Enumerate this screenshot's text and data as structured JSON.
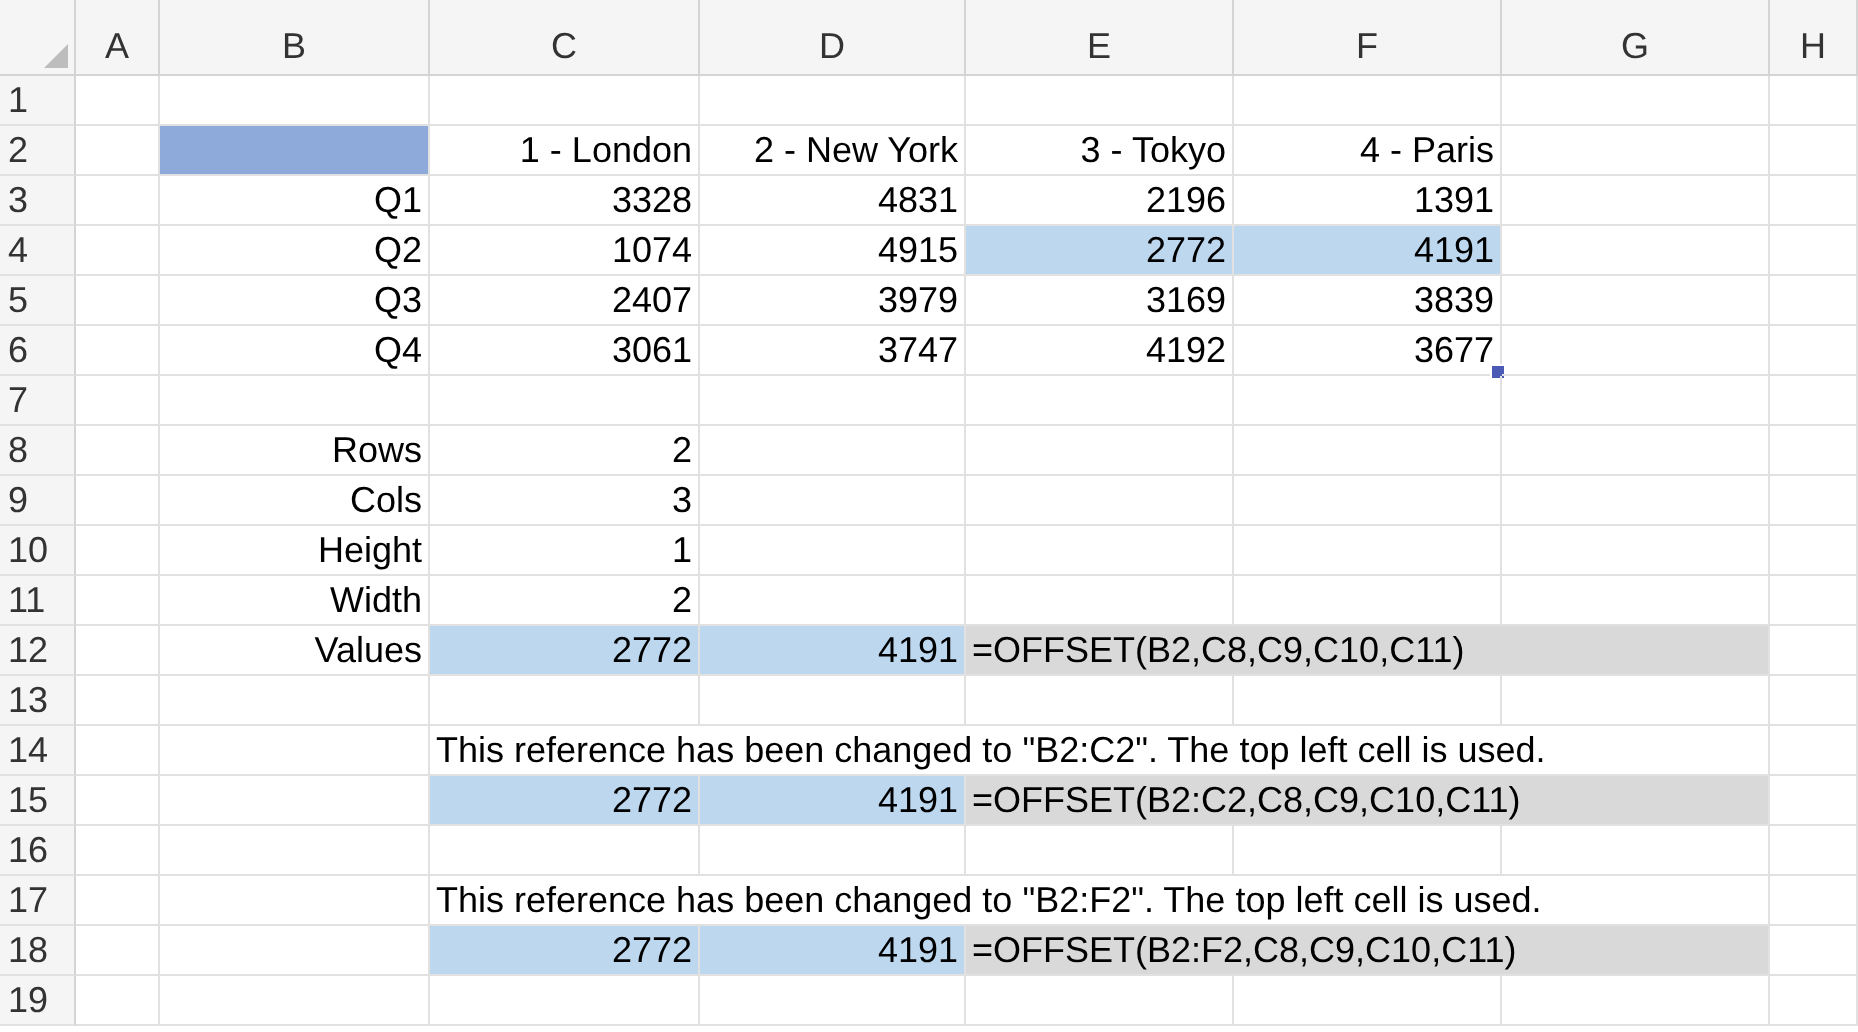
{
  "columns": [
    "A",
    "B",
    "C",
    "D",
    "E",
    "F",
    "G",
    "H"
  ],
  "rows": [
    {
      "label": "1",
      "cells": [
        {
          "kind": "blank"
        },
        {
          "kind": "blank"
        },
        {
          "kind": "blank"
        },
        {
          "kind": "blank"
        },
        {
          "kind": "blank"
        },
        {
          "kind": "blank"
        },
        {
          "kind": "blank"
        },
        {
          "kind": "blank"
        }
      ]
    },
    {
      "label": "2",
      "cells": [
        {
          "kind": "blank"
        },
        {
          "kind": "blank",
          "color": "#8eaadb"
        },
        {
          "kind": "label",
          "text": "1 - London"
        },
        {
          "kind": "label",
          "text": "2 - New York"
        },
        {
          "kind": "label",
          "text": "3 - Tokyo"
        },
        {
          "kind": "label",
          "text": "4 - Paris"
        },
        {
          "kind": "blank"
        },
        {
          "kind": "blank"
        }
      ]
    },
    {
      "label": "3",
      "cells": [
        {
          "kind": "blank"
        },
        {
          "kind": "label",
          "text": "Q1"
        },
        {
          "kind": "number",
          "text": "3328"
        },
        {
          "kind": "number",
          "text": "4831"
        },
        {
          "kind": "number",
          "text": "2196"
        },
        {
          "kind": "number",
          "text": "1391"
        },
        {
          "kind": "blank"
        },
        {
          "kind": "blank"
        }
      ]
    },
    {
      "label": "4",
      "cells": [
        {
          "kind": "blank"
        },
        {
          "kind": "label",
          "text": "Q2"
        },
        {
          "kind": "number",
          "text": "1074"
        },
        {
          "kind": "number",
          "text": "4915"
        },
        {
          "kind": "number",
          "text": "2772",
          "color": "#bdd7ee"
        },
        {
          "kind": "number",
          "text": "4191",
          "color": "#bdd7ee"
        },
        {
          "kind": "blank"
        },
        {
          "kind": "blank"
        }
      ]
    },
    {
      "label": "5",
      "cells": [
        {
          "kind": "blank"
        },
        {
          "kind": "label",
          "text": "Q3"
        },
        {
          "kind": "number",
          "text": "2407"
        },
        {
          "kind": "number",
          "text": "3979"
        },
        {
          "kind": "number",
          "text": "3169"
        },
        {
          "kind": "number",
          "text": "3839"
        },
        {
          "kind": "blank"
        },
        {
          "kind": "blank"
        }
      ]
    },
    {
      "label": "6",
      "cells": [
        {
          "kind": "blank"
        },
        {
          "kind": "label",
          "text": "Q4"
        },
        {
          "kind": "number",
          "text": "3061"
        },
        {
          "kind": "number",
          "text": "3747"
        },
        {
          "kind": "number",
          "text": "4192"
        },
        {
          "kind": "number",
          "text": "3677",
          "selected": true
        },
        {
          "kind": "blank"
        },
        {
          "kind": "blank"
        }
      ]
    },
    {
      "label": "7",
      "cells": [
        {
          "kind": "blank"
        },
        {
          "kind": "blank"
        },
        {
          "kind": "blank"
        },
        {
          "kind": "blank"
        },
        {
          "kind": "blank"
        },
        {
          "kind": "blank"
        },
        {
          "kind": "blank"
        },
        {
          "kind": "blank"
        }
      ]
    },
    {
      "label": "8",
      "cells": [
        {
          "kind": "blank"
        },
        {
          "kind": "label",
          "text": "Rows"
        },
        {
          "kind": "number",
          "text": "2"
        },
        {
          "kind": "blank"
        },
        {
          "kind": "blank"
        },
        {
          "kind": "blank"
        },
        {
          "kind": "blank"
        },
        {
          "kind": "blank"
        }
      ]
    },
    {
      "label": "9",
      "cells": [
        {
          "kind": "blank"
        },
        {
          "kind": "label",
          "text": "Cols"
        },
        {
          "kind": "number",
          "text": "3"
        },
        {
          "kind": "blank"
        },
        {
          "kind": "blank"
        },
        {
          "kind": "blank"
        },
        {
          "kind": "blank"
        },
        {
          "kind": "blank"
        }
      ]
    },
    {
      "label": "10",
      "cells": [
        {
          "kind": "blank"
        },
        {
          "kind": "label",
          "text": "Height"
        },
        {
          "kind": "number",
          "text": "1"
        },
        {
          "kind": "blank"
        },
        {
          "kind": "blank"
        },
        {
          "kind": "blank"
        },
        {
          "kind": "blank"
        },
        {
          "kind": "blank"
        }
      ]
    },
    {
      "label": "11",
      "cells": [
        {
          "kind": "blank"
        },
        {
          "kind": "label",
          "text": "Width"
        },
        {
          "kind": "number",
          "text": "2"
        },
        {
          "kind": "blank"
        },
        {
          "kind": "blank"
        },
        {
          "kind": "blank"
        },
        {
          "kind": "blank"
        },
        {
          "kind": "blank"
        }
      ]
    },
    {
      "label": "12",
      "cells": [
        {
          "kind": "blank"
        },
        {
          "kind": "label",
          "text": "Values"
        },
        {
          "kind": "number",
          "text": "2772",
          "color": "#bdd7ee"
        },
        {
          "kind": "number",
          "text": "4191",
          "color": "#bdd7ee"
        },
        {
          "kind": "text",
          "text": "=OFFSET(B2,C8,C9,C10,C11)",
          "color": "#d9d9d9"
        },
        {
          "kind": "covered",
          "color": "#d9d9d9"
        },
        {
          "kind": "covered",
          "color": "#d9d9d9"
        },
        {
          "kind": "blank"
        }
      ]
    },
    {
      "label": "13",
      "cells": [
        {
          "kind": "blank"
        },
        {
          "kind": "blank"
        },
        {
          "kind": "blank"
        },
        {
          "kind": "blank"
        },
        {
          "kind": "blank"
        },
        {
          "kind": "blank"
        },
        {
          "kind": "blank"
        },
        {
          "kind": "blank"
        }
      ]
    },
    {
      "label": "14",
      "cells": [
        {
          "kind": "blank"
        },
        {
          "kind": "blank"
        },
        {
          "kind": "text",
          "text": "This reference has been changed to \"B2:C2\". The top left cell is used."
        },
        {
          "kind": "covered"
        },
        {
          "kind": "covered"
        },
        {
          "kind": "covered"
        },
        {
          "kind": "covered"
        },
        {
          "kind": "blank"
        }
      ]
    },
    {
      "label": "15",
      "cells": [
        {
          "kind": "blank"
        },
        {
          "kind": "blank"
        },
        {
          "kind": "number",
          "text": "2772",
          "color": "#bdd7ee"
        },
        {
          "kind": "number",
          "text": "4191",
          "color": "#bdd7ee"
        },
        {
          "kind": "text",
          "text": "=OFFSET(B2:C2,C8,C9,C10,C11)",
          "color": "#d9d9d9"
        },
        {
          "kind": "covered",
          "color": "#d9d9d9"
        },
        {
          "kind": "covered",
          "color": "#d9d9d9"
        },
        {
          "kind": "blank"
        }
      ]
    },
    {
      "label": "16",
      "cells": [
        {
          "kind": "blank"
        },
        {
          "kind": "blank"
        },
        {
          "kind": "blank"
        },
        {
          "kind": "blank"
        },
        {
          "kind": "blank"
        },
        {
          "kind": "blank"
        },
        {
          "kind": "blank"
        },
        {
          "kind": "blank"
        }
      ]
    },
    {
      "label": "17",
      "cells": [
        {
          "kind": "blank"
        },
        {
          "kind": "blank"
        },
        {
          "kind": "text",
          "text": "This reference has been changed to \"B2:F2\". The top left cell is used."
        },
        {
          "kind": "covered"
        },
        {
          "kind": "covered"
        },
        {
          "kind": "covered"
        },
        {
          "kind": "covered"
        },
        {
          "kind": "blank"
        }
      ]
    },
    {
      "label": "18",
      "cells": [
        {
          "kind": "blank"
        },
        {
          "kind": "blank"
        },
        {
          "kind": "number",
          "text": "2772",
          "color": "#bdd7ee"
        },
        {
          "kind": "number",
          "text": "4191",
          "color": "#bdd7ee"
        },
        {
          "kind": "text",
          "text": "=OFFSET(B2:F2,C8,C9,C10,C11)",
          "color": "#d9d9d9"
        },
        {
          "kind": "covered",
          "color": "#d9d9d9"
        },
        {
          "kind": "covered",
          "color": "#d9d9d9"
        },
        {
          "kind": "blank"
        }
      ]
    },
    {
      "label": "19",
      "cells": [
        {
          "kind": "blank"
        },
        {
          "kind": "blank"
        },
        {
          "kind": "blank"
        },
        {
          "kind": "blank"
        },
        {
          "kind": "blank"
        },
        {
          "kind": "blank"
        },
        {
          "kind": "blank"
        },
        {
          "kind": "blank"
        }
      ]
    }
  ]
}
